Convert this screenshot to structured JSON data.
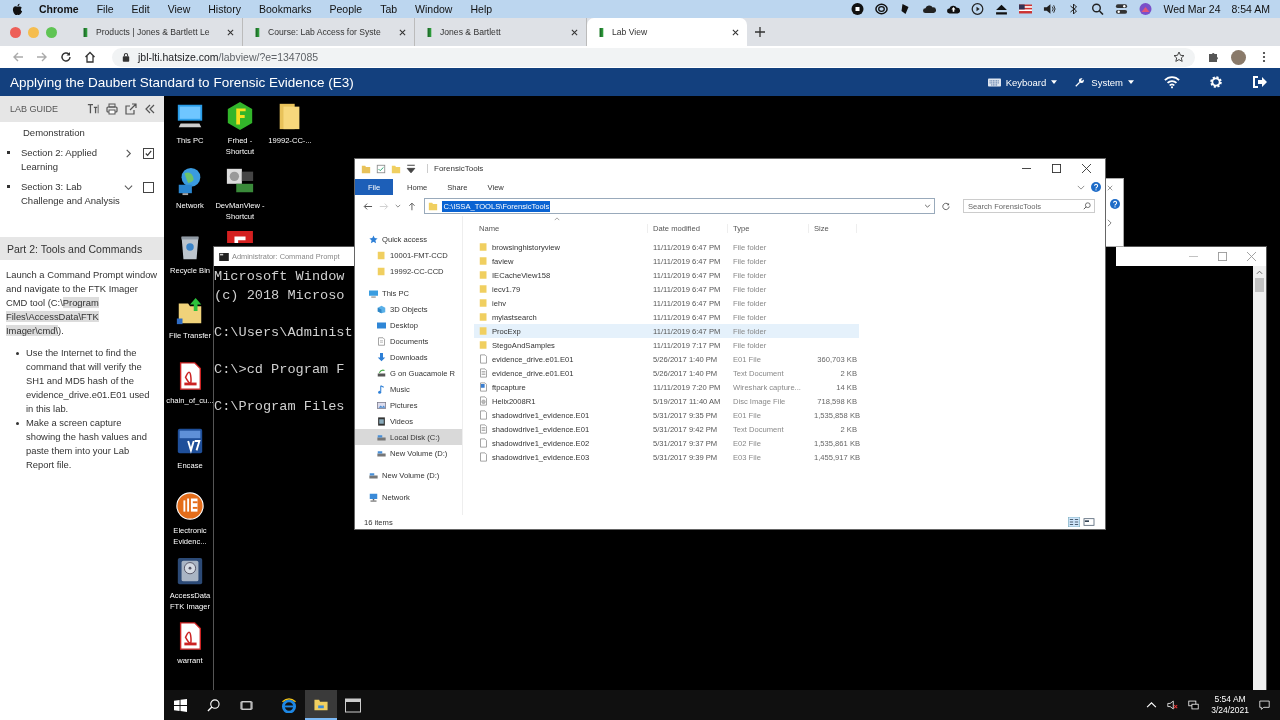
{
  "menubar": {
    "app": "Chrome",
    "menus": [
      "File",
      "Edit",
      "View",
      "History",
      "Bookmarks",
      "People",
      "Tab",
      "Window",
      "Help"
    ],
    "date": "Wed Mar 24",
    "time": "8:54 AM"
  },
  "tabs": [
    {
      "title": "Products | Jones & Bartlett Le",
      "selected": false
    },
    {
      "title": "Course: Lab Access for Syste",
      "selected": false
    },
    {
      "title": "Jones & Bartlett",
      "selected": false
    },
    {
      "title": "Lab View",
      "selected": true
    }
  ],
  "url": {
    "host": "jbl-lti.hatsize.com",
    "path": "/labview/?e=1347085"
  },
  "header": {
    "title": "Applying the Daubert Standard to Forensic Evidence (E3)",
    "menus": [
      "Keyboard",
      "System"
    ]
  },
  "sidebar": {
    "heading": "LAB GUIDE",
    "outline": [
      {
        "kind": "tail",
        "title": "Demonstration"
      },
      {
        "kind": "section",
        "title": "Section 2: Applied Learning",
        "expanded": false,
        "checked": true
      },
      {
        "kind": "section",
        "title": "Section 3: Lab Challenge and Analysis",
        "expanded": true,
        "checked": false
      }
    ],
    "part_title": "Part 2: Tools and Commands",
    "intro": {
      "before": "Launch a Command Prompt window and navigate to the FTK Imager CMD tool (C:\\",
      "highlight": "Program Files\\AccessData\\FTK Imager\\cmd\\",
      "after": ")."
    },
    "bullets": [
      "Use the Internet to find the command that will verify the SH1 and MD5 hash of the evidence_drive.e01.E01 used in this lab.",
      "Make a screen capture showing the hash values and paste them into your Lab Report file."
    ]
  },
  "desktop": {
    "columns": [
      [
        {
          "kind": "computer",
          "label": "This PC"
        },
        {
          "kind": "network",
          "label": "Network"
        },
        {
          "kind": "recycle",
          "label": "Recycle Bin"
        },
        {
          "kind": "transfer",
          "label": "File Transfer"
        },
        {
          "kind": "pdf",
          "label": "chain_of_cu..."
        },
        {
          "kind": "encase",
          "label": "Encase"
        },
        {
          "kind": "evidence",
          "label": "Electronic Evidenc..."
        },
        {
          "kind": "ftk",
          "label": "AccessData FTK Imager"
        },
        {
          "kind": "pdf",
          "label": "warrant"
        }
      ],
      [
        {
          "kind": "frhed",
          "label": "Frhed - Shortcut"
        },
        {
          "kind": "devman",
          "label": "DevManView - Shortcut"
        },
        {
          "kind": "redapp"
        }
      ],
      [
        {
          "kind": "folder",
          "label": "19992-CC-..."
        }
      ]
    ]
  },
  "cmd": {
    "title": "Administrator: Command Prompt",
    "blocks": [
      [
        "Microsoft Window",
        "(c) 2018 Microso"
      ],
      [
        "C:\\Users\\Administ"
      ],
      [
        "C:\\>cd Program F"
      ],
      [
        "C:\\Program Files"
      ]
    ]
  },
  "explorer": {
    "title": "ForensicTools",
    "ribbon": [
      {
        "label": "File",
        "kind": "menu"
      },
      {
        "label": "Home",
        "kind": "tab"
      },
      {
        "label": "Share",
        "kind": "tab"
      },
      {
        "label": "View",
        "kind": "tab"
      }
    ],
    "address": {
      "value": "C:\\ISSA_TOOLS\\ForensicTools",
      "selected": true
    },
    "search": {
      "placeholder": "Search ForensicTools"
    },
    "nav": [
      {
        "label": "Quick access",
        "kind": "star",
        "selected": false,
        "children": [
          {
            "label": "10001-FMT-CCD",
            "kind": "folder",
            "selected": false
          },
          {
            "label": "19992-CC-CCD",
            "kind": "folder",
            "selected": false
          }
        ]
      },
      {
        "label": "This PC",
        "kind": "pc",
        "selected": false,
        "children": [
          {
            "label": "3D Objects",
            "kind": "cube",
            "selected": false
          },
          {
            "label": "Desktop",
            "kind": "desktop",
            "selected": false
          },
          {
            "label": "Documents",
            "kind": "docs",
            "selected": false
          },
          {
            "label": "Downloads",
            "kind": "download",
            "selected": false
          },
          {
            "label": "G on Guacamole R",
            "kind": "netdrive",
            "selected": false
          },
          {
            "label": "Music",
            "kind": "music",
            "selected": false
          },
          {
            "label": "Pictures",
            "kind": "pictures",
            "selected": false
          },
          {
            "label": "Videos",
            "kind": "videos",
            "selected": false
          },
          {
            "label": "Local Disk (C:)",
            "kind": "drive",
            "selected": true
          },
          {
            "label": "New Volume (D:)",
            "kind": "drive",
            "selected": false
          }
        ]
      },
      {
        "label": "New Volume (D:)",
        "kind": "drive",
        "selected": false
      },
      {
        "label": "Network",
        "kind": "network",
        "selected": false
      }
    ],
    "columns": [
      "Name",
      "Date modified",
      "Type",
      "Size"
    ],
    "rows": [
      {
        "kind": "folder",
        "name": "browsinghistoryview",
        "date": "11/11/2019 6:47 PM",
        "type": "File folder",
        "selected": false
      },
      {
        "kind": "folder",
        "name": "faview",
        "date": "11/11/2019 6:47 PM",
        "type": "File folder",
        "selected": false
      },
      {
        "kind": "folder",
        "name": "IECacheView158",
        "date": "11/11/2019 6:47 PM",
        "type": "File folder",
        "selected": false
      },
      {
        "kind": "folder",
        "name": "iecv1.79",
        "date": "11/11/2019 6:47 PM",
        "type": "File folder",
        "selected": false
      },
      {
        "kind": "folder",
        "name": "iehv",
        "date": "11/11/2019 6:47 PM",
        "type": "File folder",
        "selected": false
      },
      {
        "kind": "folder",
        "name": "mylastsearch",
        "date": "11/11/2019 6:47 PM",
        "type": "File folder",
        "selected": false
      },
      {
        "kind": "folder",
        "name": "ProcExp",
        "date": "11/11/2019 6:47 PM",
        "type": "File folder",
        "selected": true
      },
      {
        "kind": "folder",
        "name": "StegoAndSamples",
        "date": "11/11/2019 7:17 PM",
        "type": "File folder",
        "selected": false
      },
      {
        "kind": "file",
        "name": "evidence_drive.e01.E01",
        "date": "5/26/2017 1:40 PM",
        "type": "E01 File",
        "size": "360,703 KB",
        "selected": false
      },
      {
        "kind": "text",
        "name": "evidence_drive.e01.E01",
        "date": "5/26/2017 1:40 PM",
        "type": "Text Document",
        "size": "2 KB",
        "selected": false
      },
      {
        "kind": "capture",
        "name": "ftpcapture",
        "date": "11/11/2019 7:20 PM",
        "type": "Wireshark capture...",
        "size": "14 KB",
        "selected": false
      },
      {
        "kind": "disc",
        "name": "Helix2008R1",
        "date": "5/19/2017 11:40 AM",
        "type": "Disc Image File",
        "size": "718,598 KB",
        "selected": false
      },
      {
        "kind": "file",
        "name": "shadowdrive1_evidence.E01",
        "date": "5/31/2017 9:35 PM",
        "type": "E01 File",
        "size": "1,535,858 KB",
        "selected": false
      },
      {
        "kind": "text",
        "name": "shadowdrive1_evidence.E01",
        "date": "5/31/2017 9:42 PM",
        "type": "Text Document",
        "size": "2 KB",
        "selected": false
      },
      {
        "kind": "file",
        "name": "shadowdrive1_evidence.E02",
        "date": "5/31/2017 9:37 PM",
        "type": "E02 File",
        "size": "1,535,861 KB",
        "selected": false
      },
      {
        "kind": "file",
        "name": "shadowdrive1_evidence.E03",
        "date": "5/31/2017 9:39 PM",
        "type": "E03 File",
        "size": "1,455,917 KB",
        "selected": false
      }
    ],
    "status": "16 items"
  },
  "taskbar": {
    "apps": [
      {
        "kind": "browser",
        "active": false
      },
      {
        "kind": "explorer",
        "active": true
      },
      {
        "kind": "terminal",
        "active": false
      }
    ],
    "time": "5:54 AM",
    "date": "3/24/2021"
  }
}
